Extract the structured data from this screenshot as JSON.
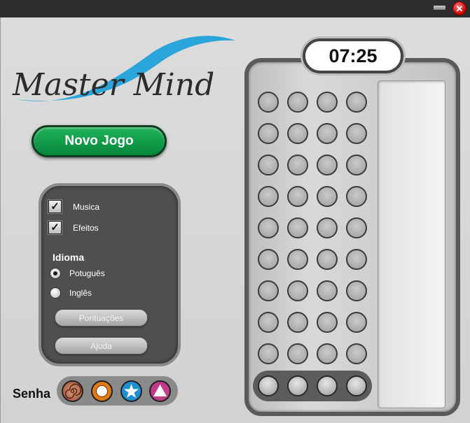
{
  "titlebar": {
    "close_glyph": "✕"
  },
  "logo": {
    "text": "Master Mind",
    "swoosh_color": "#2aa5dc"
  },
  "new_game": {
    "label": "Novo Jogo",
    "color": "#0a9a45"
  },
  "options": {
    "music": {
      "label": "Musica",
      "checked": true
    },
    "effects": {
      "label": "Efeitos",
      "checked": true
    },
    "language_heading": "Idioma",
    "languages": [
      {
        "label": "Potuguês",
        "selected": true
      },
      {
        "label": "Inglês",
        "selected": false
      }
    ],
    "scores_label": "Pontuações",
    "help_label": "Ajuda"
  },
  "timer": {
    "value": "07:25"
  },
  "board": {
    "rows": 9,
    "columns": 4
  },
  "code": {
    "label": "Senha",
    "pegs": [
      {
        "name": "spiral-peg",
        "color": "#b86a4a"
      },
      {
        "name": "ring-peg",
        "color": "#e07a14"
      },
      {
        "name": "star-peg",
        "color": "#1e8fcf"
      },
      {
        "name": "triangle-peg",
        "color": "#c23a8a"
      }
    ]
  }
}
